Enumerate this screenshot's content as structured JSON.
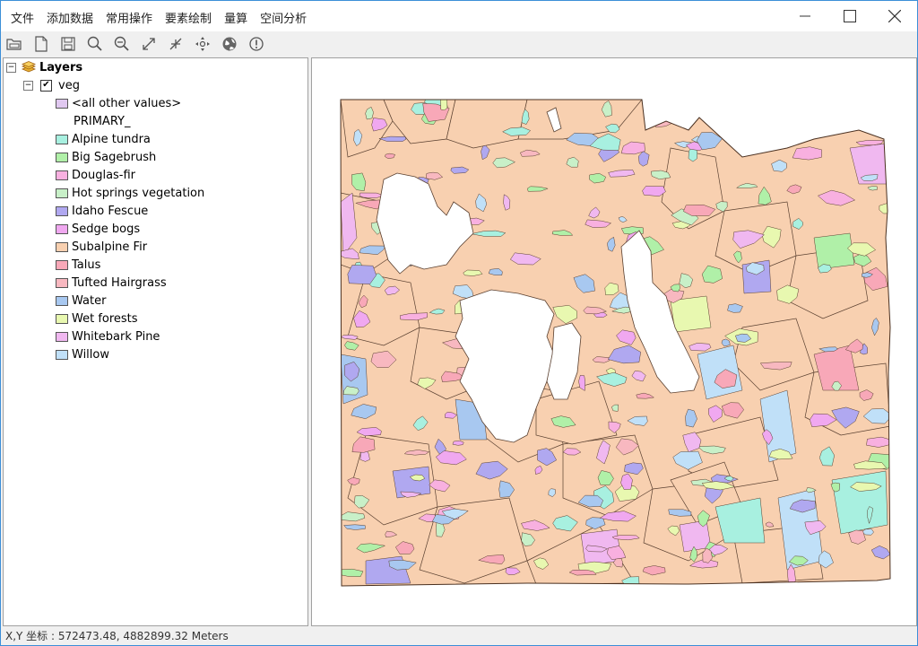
{
  "menu": {
    "items": [
      "文件",
      "添加数据",
      "常用操作",
      "要素绘制",
      "量算",
      "空间分析"
    ]
  },
  "toolbar": {
    "tools": [
      "open-icon",
      "new-document-icon",
      "save-icon",
      "zoom-in-icon",
      "zoom-out-icon",
      "full-extent-icon",
      "fixed-zoom-icon",
      "pan-icon",
      "globe-icon",
      "identify-icon"
    ]
  },
  "toc": {
    "root_label": "Layers",
    "layer": {
      "name": "veg",
      "checked": true,
      "check_glyph": "✔"
    },
    "default_label": "<all other values>",
    "field_label": "PRIMARY_",
    "legend": [
      {
        "label": "Alpine tundra",
        "color": "#a8f0e0"
      },
      {
        "label": "Big Sagebrush",
        "color": "#b0f0a8"
      },
      {
        "label": "Douglas-fir",
        "color": "#f8b0e0"
      },
      {
        "label": "Hot springs vegetation",
        "color": "#c8f0c8"
      },
      {
        "label": "Idaho Fescue",
        "color": "#b0a8f0"
      },
      {
        "label": "Sedge bogs",
        "color": "#f0a8f0"
      },
      {
        "label": "Subalpine Fir",
        "color": "#f8d0b0"
      },
      {
        "label": "Talus",
        "color": "#f8a8b8"
      },
      {
        "label": "Tufted Hairgrass",
        "color": "#f8b8c0"
      },
      {
        "label": "Water",
        "color": "#a8c8f0"
      },
      {
        "label": "Wet forests",
        "color": "#e8f8b0"
      },
      {
        "label": "Whitebark Pine",
        "color": "#f0b8f0"
      },
      {
        "label": "Willow",
        "color": "#c0e0f8"
      }
    ],
    "default_color": "#e0c8f0"
  },
  "status": {
    "text": "X,Y 坐标 : 572473.48, 4882899.32  Meters"
  },
  "colors": {
    "accent": "#3c8fd8",
    "subalpine_fir": "#f8d0b0"
  }
}
